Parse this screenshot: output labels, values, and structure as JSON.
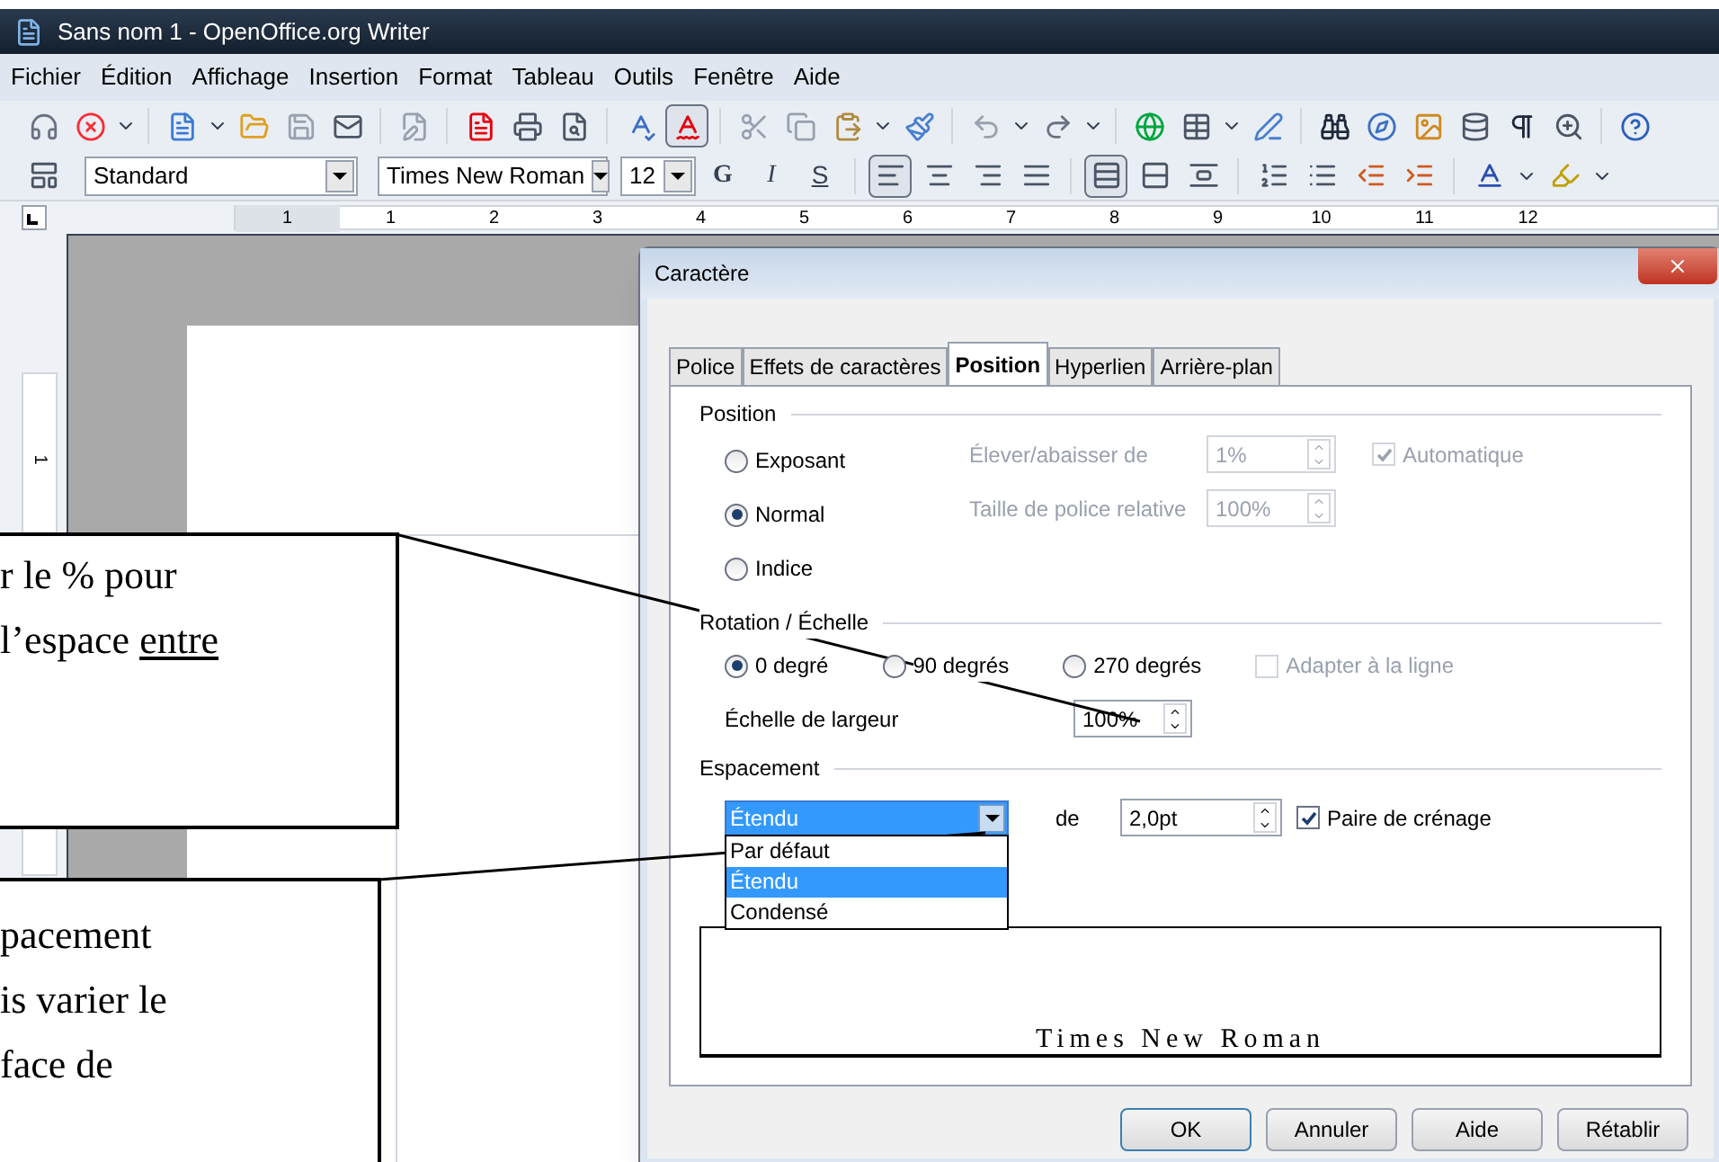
{
  "window": {
    "title": "Sans nom 1 - OpenOffice.org Writer"
  },
  "menu": [
    "Fichier",
    "Édition",
    "Affichage",
    "Insertion",
    "Format",
    "Tableau",
    "Outils",
    "Fenêtre",
    "Aide"
  ],
  "toolbar": {
    "auto_spellcheck_on": true
  },
  "formatting": {
    "style": "Standard",
    "font": "Times New Roman",
    "size": "12",
    "text_buttons": [
      "G",
      "I",
      "S"
    ],
    "alignment_buttons": [
      {
        "selected": true
      },
      {
        "selected": false
      },
      {
        "selected": false
      },
      {
        "selected": false
      }
    ],
    "line_spacing_buttons": [
      {
        "selected": true
      },
      {
        "selected": false
      },
      {
        "selected": false
      }
    ]
  },
  "ruler": {
    "labels": [
      "1",
      "1",
      "2",
      "3",
      "4",
      "5",
      "6",
      "7",
      "8",
      "9",
      "10",
      "11",
      "12"
    ]
  },
  "vertical_ruler": {
    "labels": [
      "1"
    ]
  },
  "callouts": [
    {
      "lines": [
        [
          {
            "text": "r le % pour"
          }
        ],
        [
          {
            "text": "l’espace "
          },
          {
            "text": "entre",
            "underline": true
          }
        ]
      ]
    },
    {
      "lines": [
        [
          {
            "text": "pacement"
          }
        ],
        [
          {
            "text": "is varier le"
          }
        ],
        [
          {
            "text": "face de"
          }
        ]
      ]
    }
  ],
  "dialog": {
    "title": "Caractère",
    "tabs": [
      {
        "label": "Police",
        "selected": false
      },
      {
        "label": "Effets de caractères",
        "selected": false
      },
      {
        "label": "Position",
        "selected": true
      },
      {
        "label": "Hyperlien",
        "selected": false
      },
      {
        "label": "Arrière-plan",
        "selected": false
      }
    ],
    "position": {
      "heading": "Position",
      "options": [
        {
          "label": "Exposant",
          "selected": false
        },
        {
          "label": "Normal",
          "selected": true
        },
        {
          "label": "Indice",
          "selected": false
        }
      ],
      "raise_label": "Élever/abaisser de",
      "raise_value": "1%",
      "raise_disabled": true,
      "size_label": "Taille de police relative",
      "size_value": "100%",
      "size_disabled": true,
      "automatic": {
        "label": "Automatique",
        "checked": true,
        "disabled": true
      }
    },
    "rotation": {
      "heading": "Rotation / Échelle",
      "options": [
        {
          "label": "0 degré",
          "selected": true
        },
        {
          "label": "90 degrés",
          "selected": false
        },
        {
          "label": "270 degrés",
          "selected": false
        }
      ],
      "fit": {
        "label": "Adapter à la ligne",
        "checked": false,
        "disabled": true
      },
      "scale_label": "Échelle de largeur",
      "scale_value": "100%"
    },
    "spacing": {
      "heading": "Espacement",
      "value": "Étendu",
      "expanded": true,
      "options": [
        {
          "label": "Par défaut",
          "selected": false
        },
        {
          "label": "Étendu",
          "selected": true
        },
        {
          "label": "Condensé",
          "selected": false
        }
      ],
      "by_label": "de",
      "by_value": "2,0pt",
      "kerning": {
        "label": "Paire de crénage",
        "checked": true
      }
    },
    "preview": "Times New Roman",
    "buttons": [
      "OK",
      "Annuler",
      "Aide",
      "Rétablir"
    ]
  }
}
